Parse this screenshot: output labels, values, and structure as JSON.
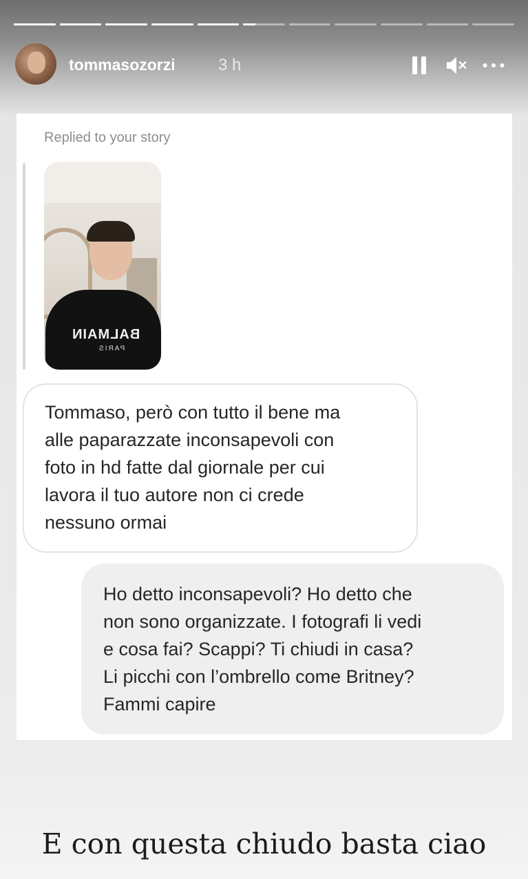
{
  "progress": {
    "segments": [
      1,
      1,
      1,
      1,
      1,
      0.3,
      0,
      0,
      0,
      0,
      0
    ]
  },
  "header": {
    "username": "tommasozorzi",
    "time": "3 h",
    "icons": [
      "pause-icon",
      "mute-icon",
      "more-icon"
    ]
  },
  "chat": {
    "reply_caption": "Replied to your story",
    "story_shirt_text": "BALMAIN",
    "story_shirt_sub": "PARIS",
    "incoming_message": "Tommaso, però con tutto il bene ma\nalle paparazzate inconsapevoli con\nfoto in hd fatte dal giornale per cui\nlavora il tuo autore non ci crede\nnessuno ormai",
    "outgoing_message": "Ho detto inconsapevoli? Ho detto che\nnon sono organizzate. I fotografi li vedi\ne cosa fai? Scappi? Ti chiudi in casa?\nLi picchi con l’ombrello come Britney?\nFammi capire"
  },
  "story_caption": "E con questa chiudo basta ciao"
}
